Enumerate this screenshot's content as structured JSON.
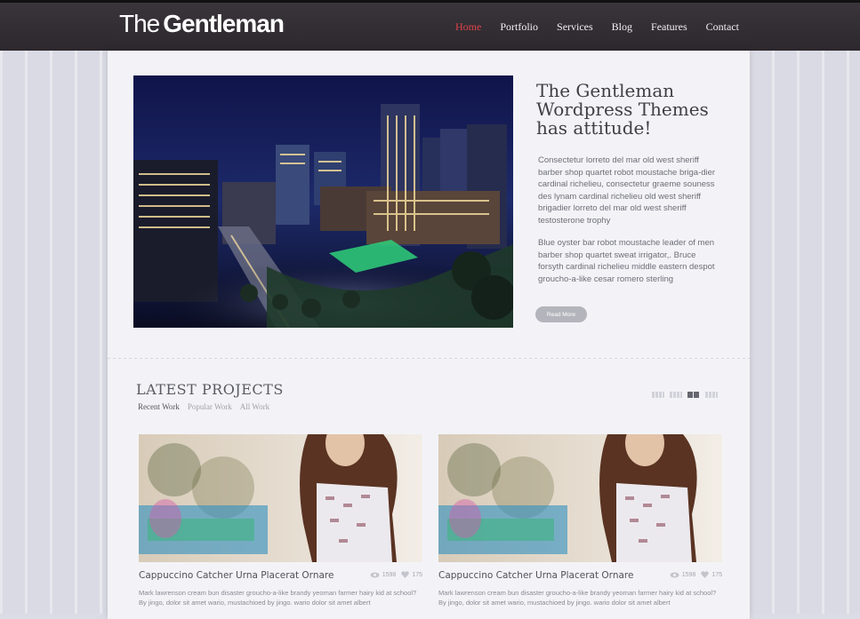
{
  "brand": {
    "light": "The",
    "bold": "Gentleman"
  },
  "nav": {
    "items": [
      "Home",
      "Portfolio",
      "Services",
      "Blog",
      "Features",
      "Contact"
    ],
    "active_color": "#e0414a"
  },
  "hero": {
    "title": "The Gentleman Wordpress Themes has attitude!",
    "paragraph1": "Consectetur lorreto del mar old west sheriff barber shop quartet robot moustache briga-dier cardinal richelieu, consectetur graeme souness des lynam cardinal richelieu old west sheriff brigadier lorreto del mar old west sheriff testosterone trophy",
    "paragraph2": "Blue oyster bar robot moustache leader of men barber shop quartet sweat irrigator,. Bruce forsyth cardinal richelieu middle eastern despot groucho-a-like cesar romero sterling",
    "read_more": "Read More"
  },
  "projects": {
    "title": "LATEST PROJECTS",
    "filters": [
      "Recent Work",
      "Popular Work",
      "All Work"
    ],
    "cards": [
      {
        "title": "Cappuccino Catcher Urna Placerat Ornare",
        "views": "1598",
        "likes": "175",
        "text": "Mark lawrenson cream bun disaster groucho-a-like brandy yeoman farmer hairy kid at school? By jingo, dolor sit amet wario, mustachioed by jingo. wario dolor sit amet albert"
      },
      {
        "title": "Cappuccino Catcher Urna Placerat Ornare",
        "views": "1598",
        "likes": "175",
        "text": "Mark lawrenson cream bun disaster groucho-a-like brandy yeoman farmer hairy kid at school? By jingo, dolor sit amet wario, mustachioed by jingo. wario dolor sit amet albert"
      }
    ]
  },
  "icons": [
    "eye-icon",
    "heart-icon",
    "grid-view-icon",
    "list-view-icon"
  ]
}
